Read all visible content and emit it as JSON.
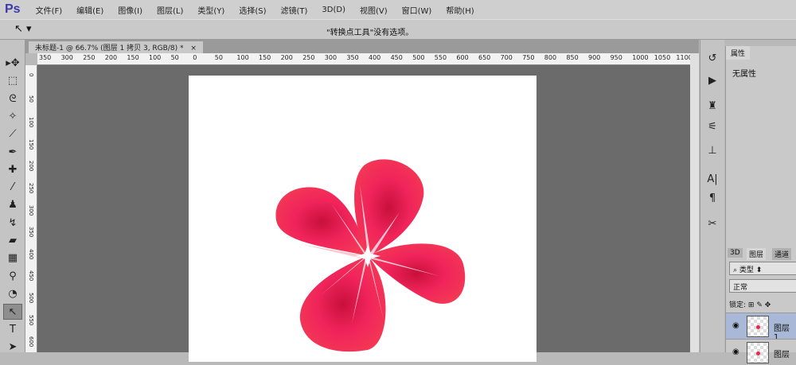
{
  "app": {
    "logo": "Ps"
  },
  "menu": [
    "文件(F)",
    "编辑(E)",
    "图像(I)",
    "图层(L)",
    "类型(Y)",
    "选择(S)",
    "滤镜(T)",
    "3D(D)",
    "视图(V)",
    "窗口(W)",
    "帮助(H)"
  ],
  "options": {
    "tool_icon": "convert-point-icon",
    "hint": "\"转换点工具\"没有选项。"
  },
  "document_tab": {
    "title": "未标题-1 @ 66.7% (图层 1 拷贝 3, RGB/8) *",
    "close": "×"
  },
  "hruler": [
    "350",
    "300",
    "250",
    "200",
    "150",
    "100",
    "50",
    "0",
    "50",
    "100",
    "150",
    "200",
    "250",
    "300",
    "350",
    "400",
    "450",
    "500",
    "550",
    "600",
    "650",
    "700",
    "750",
    "800",
    "850",
    "900",
    "950",
    "1000",
    "1050",
    "1100"
  ],
  "vruler": [
    "0",
    "50",
    "100",
    "150",
    "200",
    "250",
    "300",
    "350",
    "400",
    "450",
    "500",
    "550",
    "600"
  ],
  "tools": [
    "move",
    "marquee",
    "lasso",
    "magic-wand",
    "crop",
    "eyedropper",
    "healing",
    "brush",
    "stamp",
    "history-brush",
    "eraser",
    "gradient",
    "blur",
    "dodge",
    "convert-point",
    "type",
    "path-selection"
  ],
  "properties": {
    "tab": "属性",
    "content": "无属性"
  },
  "layers": {
    "tabs": [
      "3D",
      "图层",
      "通道"
    ],
    "filter": "类型",
    "blend": "正常",
    "lock_label": "锁定:",
    "items": [
      "图层 1",
      "图层"
    ]
  },
  "colors": {
    "petal": "#ee2a55",
    "petal_light": "#ff6c8a",
    "accent": "#3a3aa8"
  }
}
